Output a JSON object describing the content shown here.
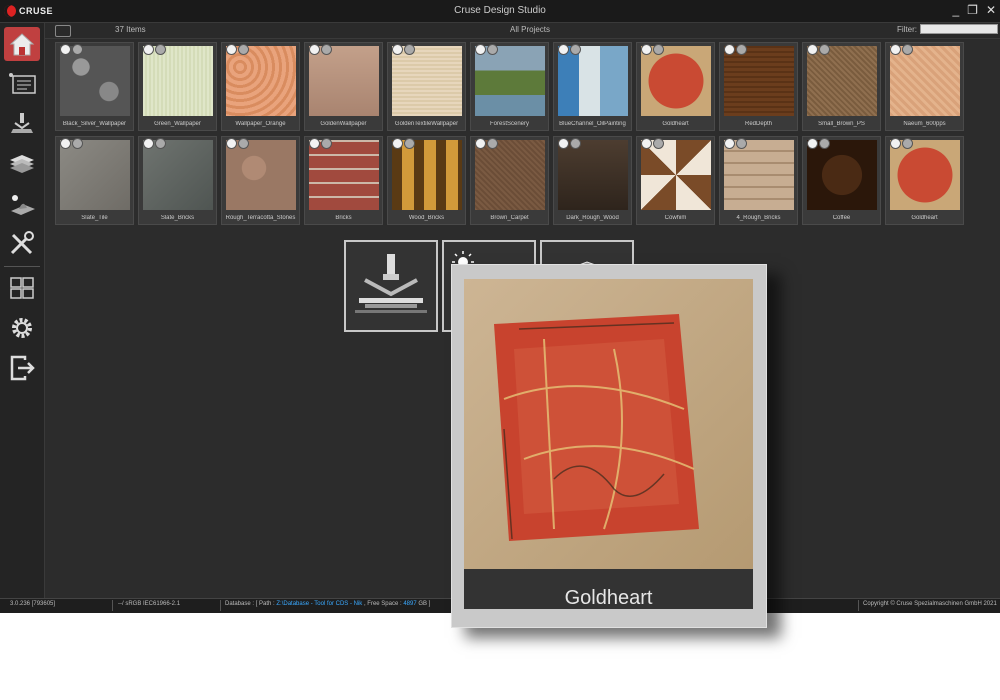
{
  "titlebar": {
    "logo_text": "CRUSE",
    "title": "Cruse Design Studio",
    "minimize": "_",
    "restore": "❐",
    "close": "✕"
  },
  "toolbar": {
    "items_count": "37 Items",
    "project": "All Projects",
    "filter_label": "Filter:",
    "filter_value": ""
  },
  "sidebar": {
    "items": [
      "home-icon",
      "layout-icon",
      "scanner-icon",
      "layers-icon",
      "light-map-icon",
      "tools-icon",
      "tiles-icon",
      "settings-icon",
      "exit-icon"
    ]
  },
  "materials": [
    {
      "label": "Black_Silver_Wallpaper"
    },
    {
      "label": "Green_Wallpaper"
    },
    {
      "label": "Wallpaper_Orange"
    },
    {
      "label": "GoldenWallpaper"
    },
    {
      "label": "GoldenTextileWallpaper"
    },
    {
      "label": "ForestScenery"
    },
    {
      "label": "BlueChannel_OilPainting"
    },
    {
      "label": "Goldheart"
    },
    {
      "label": "RedDepth"
    },
    {
      "label": "Small_Brown_PS"
    },
    {
      "label": "Naeum_600pps"
    },
    {
      "label": "Slate_Tile"
    },
    {
      "label": "Slate_Bricks"
    },
    {
      "label": "Rough_Terracotta_Stones"
    },
    {
      "label": "Bricks"
    },
    {
      "label": "Wood_Bricks"
    },
    {
      "label": "Brown_Carpet"
    },
    {
      "label": "Dark_Rough_Wood"
    },
    {
      "label": "Cowhim"
    },
    {
      "label": "4_Rough_Bricks"
    },
    {
      "label": "Coffee"
    },
    {
      "label": "Goldheart"
    }
  ],
  "tools": [
    "scan-tool-icon",
    "light-surface-icon",
    "layers-stack-icon"
  ],
  "preview": {
    "title": "Goldheart"
  },
  "statusbar": {
    "version": "3.0.236 [793605]",
    "color_space": "--/ sRGB IEC61966-2.1",
    "db_prefix": "Database : [ Path : ",
    "db_path": "Z:\\Database - Tool for CDS - Nik",
    "db_mid": " , Free Space : ",
    "db_space": "4897",
    "db_suffix": " GB ]",
    "copyright": "Copyright © Cruse Spezialmaschinen GmbH 2021"
  }
}
